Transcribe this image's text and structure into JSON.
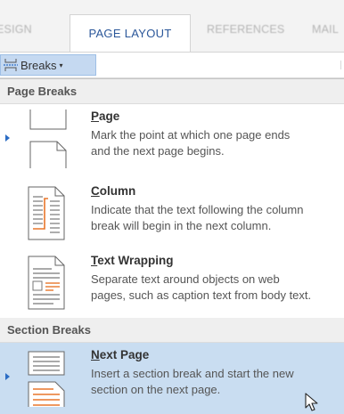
{
  "ribbon": {
    "tabs": [
      {
        "label": "ESIGN",
        "active": false
      },
      {
        "label": "PAGE LAYOUT",
        "active": true
      },
      {
        "label": "REFERENCES",
        "active": false
      },
      {
        "label": "MAIL",
        "active": false
      }
    ],
    "breaks_button": {
      "label": "Breaks",
      "icon": "breaks-icon",
      "caret": "▾"
    }
  },
  "menu": {
    "page_breaks": {
      "heading": "Page Breaks",
      "items": [
        {
          "title_accel": "P",
          "title_rest": "age",
          "desc_line1": "Mark the point at which one page ends",
          "desc_line2": "and the next page begins.",
          "icon": "page-break-icon"
        },
        {
          "title_accel": "C",
          "title_rest": "olumn",
          "desc_line1": "Indicate that the text following the column",
          "desc_line2": "break will begin in the next column.",
          "icon": "column-break-icon"
        },
        {
          "title_accel": "T",
          "title_rest": "ext Wrapping",
          "desc_line1": "Separate text around objects on web",
          "desc_line2": "pages, such as caption text from body text.",
          "icon": "text-wrapping-icon"
        }
      ]
    },
    "section_breaks": {
      "heading": "Section Breaks",
      "items": [
        {
          "title_accel": "N",
          "title_rest": "ext Page",
          "desc_line1": "Insert a section break and start the new",
          "desc_line2": "section on the next page.",
          "icon": "next-page-icon",
          "hovered": true
        }
      ]
    }
  },
  "colors": {
    "accent": "#2b579a",
    "hover": "#c9ddf1",
    "orange": "#e8762b"
  }
}
